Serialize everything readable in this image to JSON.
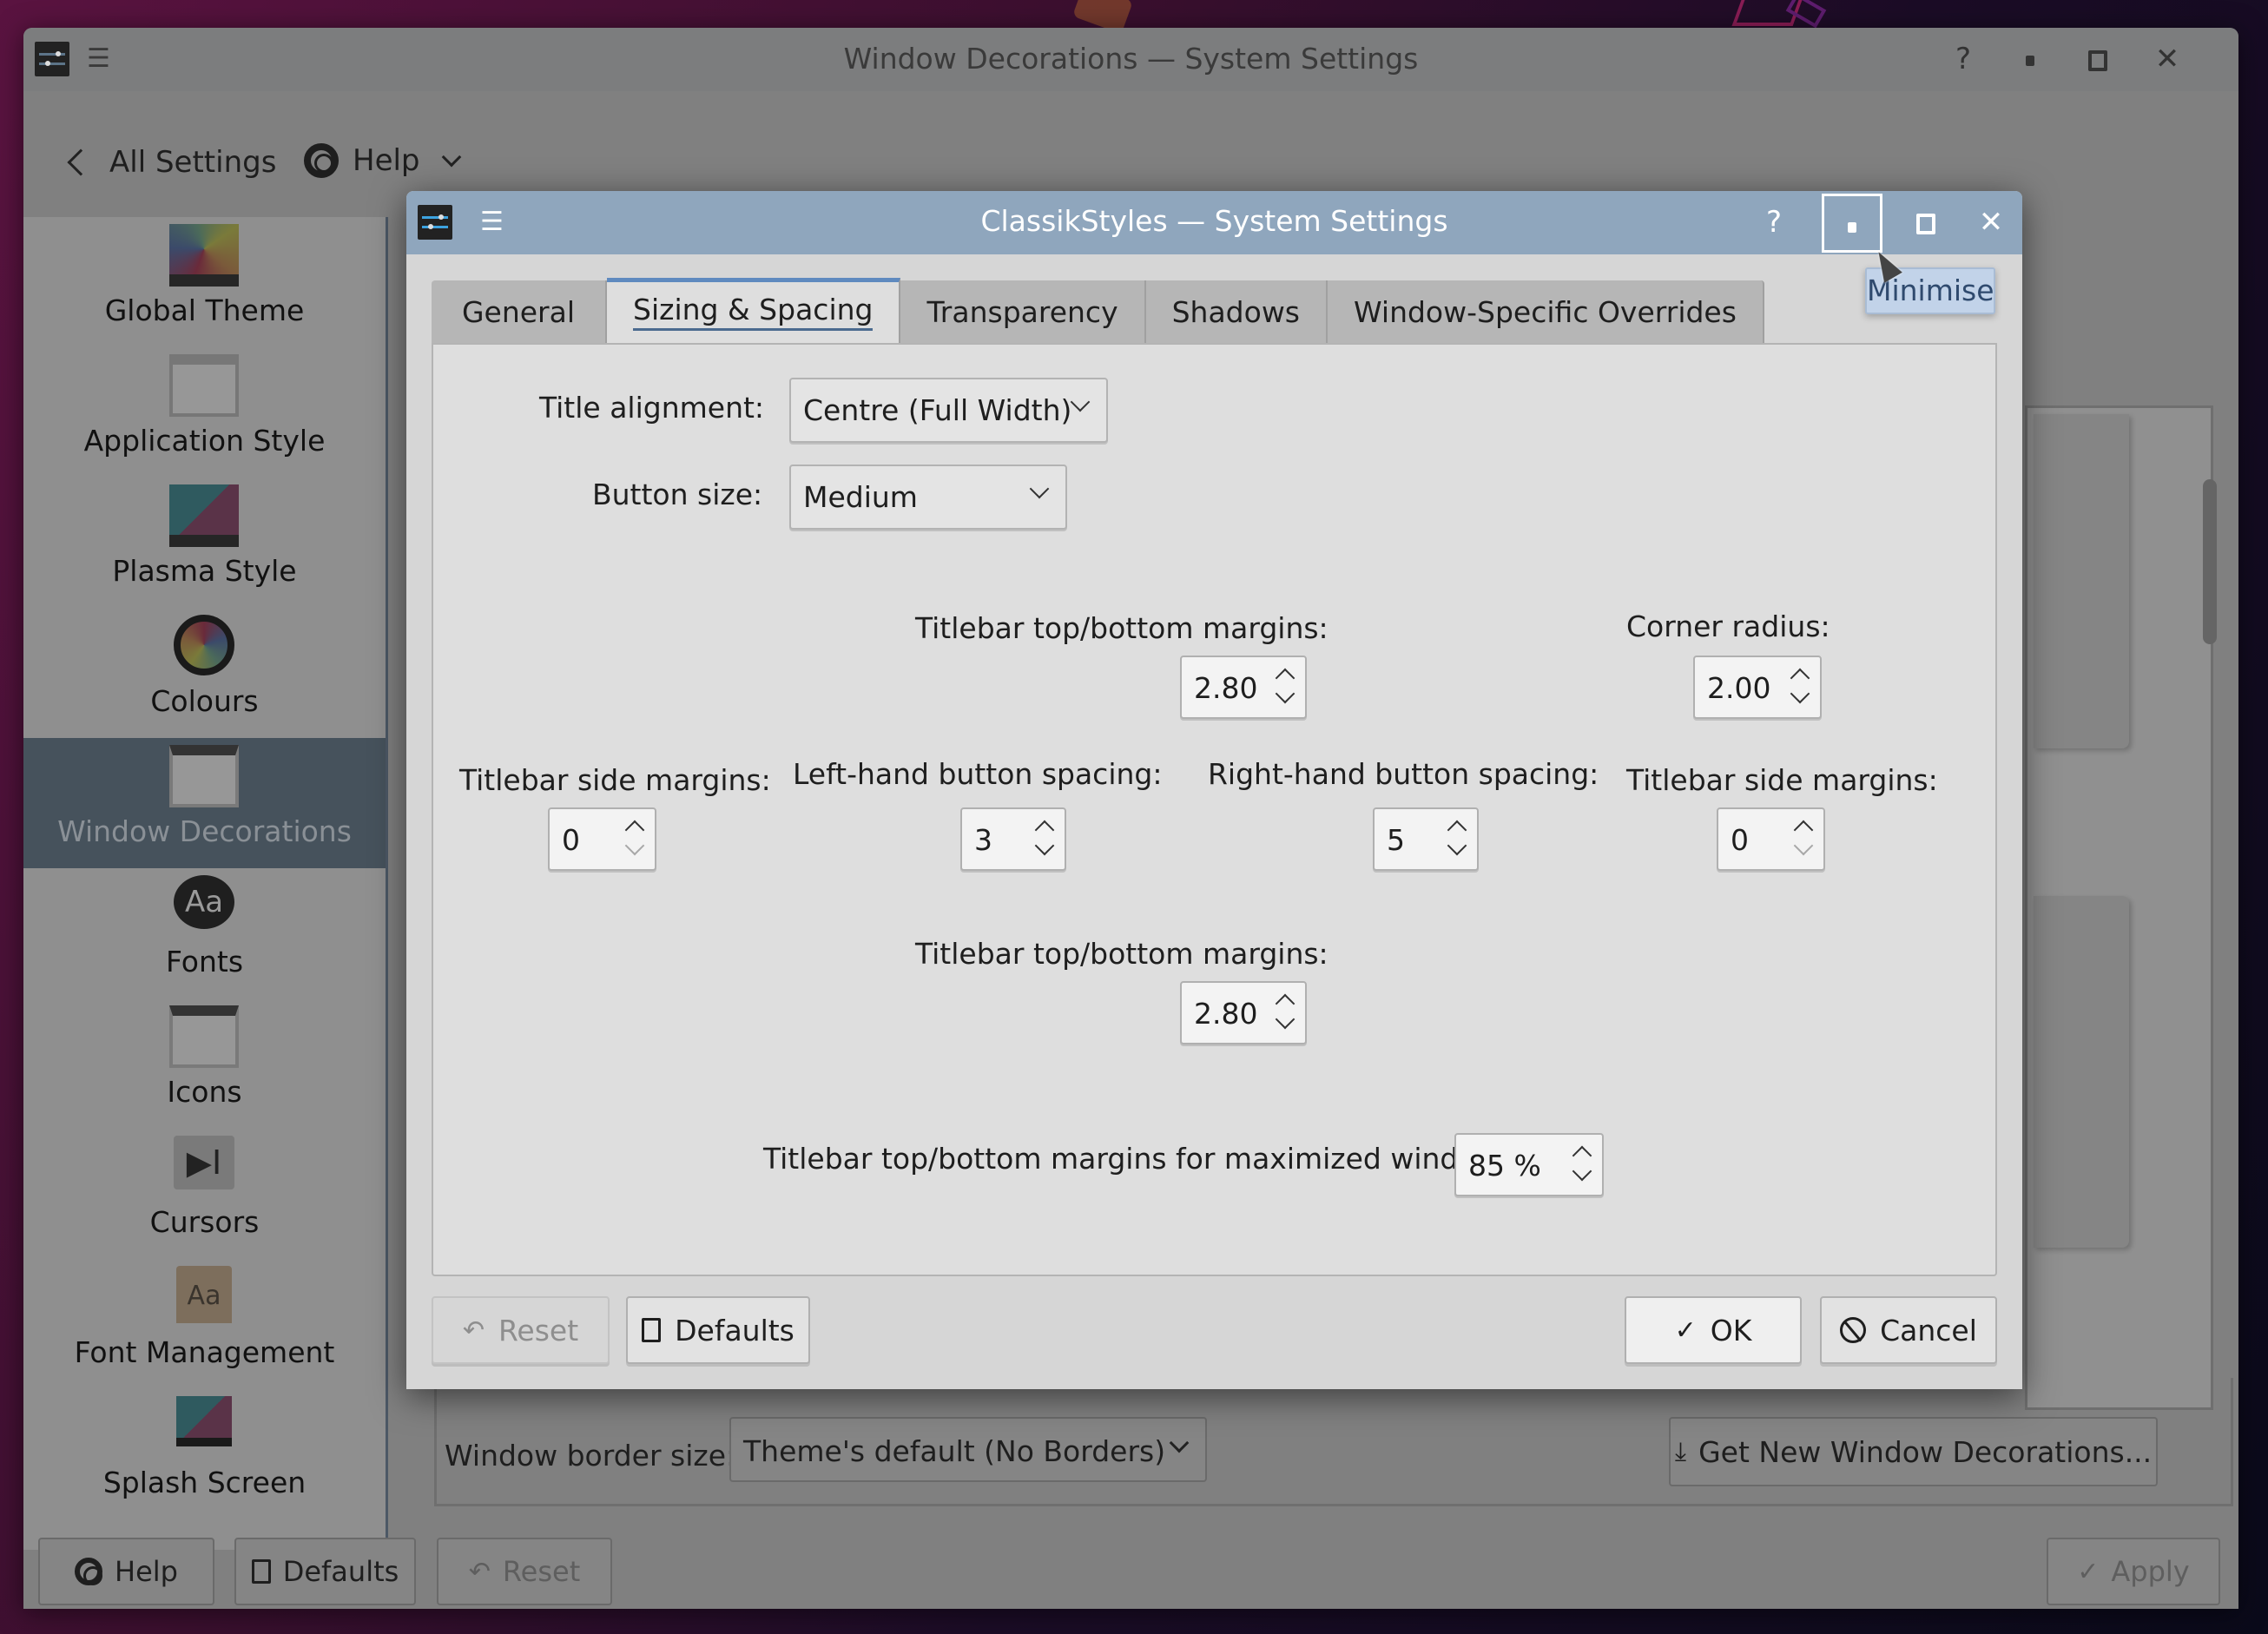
{
  "parent_window": {
    "title": "Window Decorations — System Settings",
    "titlebar_buttons": {
      "help": "?",
      "minimise": "minimise",
      "maximise": "maximise",
      "close": "✕"
    },
    "toolbar": {
      "back_label": "All Settings",
      "help_label": "Help"
    },
    "sidebar": {
      "items": [
        {
          "label": "Global Theme",
          "icon": "global-theme-icon",
          "selected": false
        },
        {
          "label": "Application Style",
          "icon": "application-style-icon",
          "selected": false
        },
        {
          "label": "Plasma Style",
          "icon": "plasma-style-icon",
          "selected": false
        },
        {
          "label": "Colours",
          "icon": "colours-icon",
          "selected": false
        },
        {
          "label": "Window Decorations",
          "icon": "window-decorations-icon",
          "selected": true
        },
        {
          "label": "Fonts",
          "icon": "fonts-icon",
          "selected": false
        },
        {
          "label": "Icons",
          "icon": "icons-icon",
          "selected": false
        },
        {
          "label": "Cursors",
          "icon": "cursors-icon",
          "selected": false
        },
        {
          "label": "Font Management",
          "icon": "font-management-icon",
          "selected": false
        },
        {
          "label": "Splash Screen",
          "icon": "splash-screen-icon",
          "selected": false
        }
      ]
    },
    "content": {
      "border_size_label": "Window border size:",
      "border_size_value": "Theme's default (No Borders)",
      "get_new_label": "Get New Window Decorations..."
    },
    "bottom_bar": {
      "help_label": "Help",
      "defaults_label": "Defaults",
      "reset_label": "Reset",
      "apply_label": "Apply"
    },
    "glyphs": {
      "menu": "☰",
      "check": "✓",
      "reset": "↶",
      "download": "⤓",
      "fonts_icon_text": "Aa",
      "cursor_icon_text": "▶I"
    }
  },
  "dialog": {
    "title": "ClassikStyles — System Settings",
    "titlebar_buttons": {
      "help": "?",
      "close": "✕"
    },
    "tooltip": "Minimise",
    "tabs": [
      {
        "label": "General",
        "active": false
      },
      {
        "label": "Sizing & Spacing",
        "active": true
      },
      {
        "label": "Transparency",
        "active": false
      },
      {
        "label": "Shadows",
        "active": false
      },
      {
        "label": "Window-Specific Overrides",
        "active": false
      }
    ],
    "fields": {
      "title_alignment": {
        "label": "Title alignment:",
        "value": "Centre (Full Width)"
      },
      "button_size": {
        "label": "Button size:",
        "value": "Medium"
      },
      "top_margins_1": {
        "label": "Titlebar top/bottom margins:",
        "value": "2.80"
      },
      "corner_radius": {
        "label": "Corner radius:",
        "value": "2.00"
      },
      "side_margins_left": {
        "label": "Titlebar side margins:",
        "value": "0"
      },
      "left_button_spacing": {
        "label": "Left-hand button spacing:",
        "value": "3"
      },
      "right_button_spacing": {
        "label": "Right-hand button spacing:",
        "value": "5"
      },
      "side_margins_right": {
        "label": "Titlebar side margins:",
        "value": "0"
      },
      "top_margins_2": {
        "label": "Titlebar top/bottom margins:",
        "value": "2.80"
      },
      "maximized_margins": {
        "label": "Titlebar top/bottom margins for maximized windows:",
        "value": "85 %"
      }
    },
    "buttons": {
      "reset_label": "Reset",
      "defaults_label": "Defaults",
      "ok_label": "OK",
      "cancel_label": "Cancel"
    }
  },
  "colors": {
    "dialog_titlebar": "#8fa6bd",
    "tab_accent": "#5f8abf",
    "sidebar_selected": "#46525c",
    "tooltip_bg": "#c2d3e9"
  }
}
